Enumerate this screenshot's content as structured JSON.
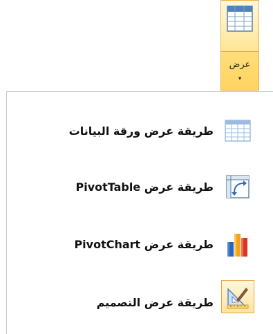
{
  "ribbon": {
    "view_button": {
      "label": "عرض",
      "arrow": "▾",
      "icon": "datasheet-grid-icon"
    }
  },
  "menu": {
    "items": [
      {
        "label": "طريقة عرض ورقة البيانات",
        "icon": "datasheet-view-icon",
        "selected": false
      },
      {
        "label": "طريقة عرض PivotTable",
        "icon": "pivottable-view-icon",
        "selected": false
      },
      {
        "label": "طريقة عرض PivotChart",
        "icon": "pivotchart-view-icon",
        "selected": false
      },
      {
        "label": "طريقة عرض التصميم",
        "icon": "design-view-icon",
        "selected": true
      }
    ]
  },
  "colors": {
    "highlight_border": "#e3a641",
    "highlight_fill": "#ffe4a1",
    "grid_blue": "#4f81bd"
  }
}
